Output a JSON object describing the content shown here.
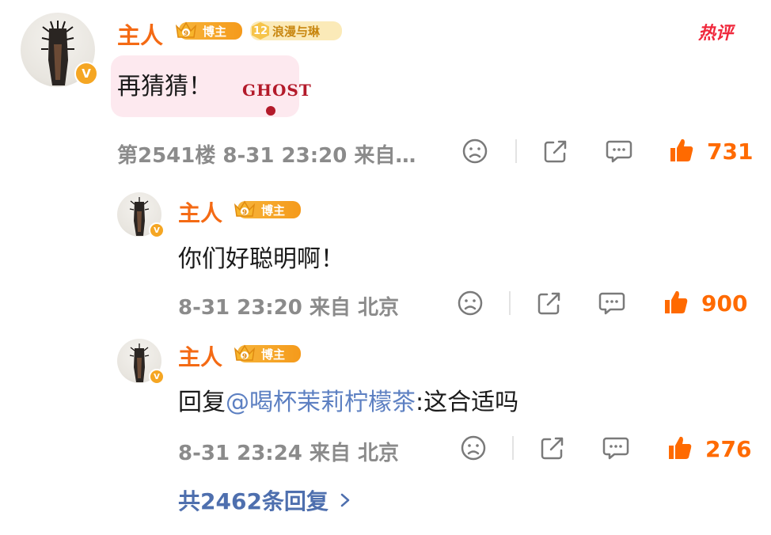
{
  "main_comment": {
    "author": "主人",
    "blogger_badge": "博主",
    "fan_level": "12",
    "fan_badge": "浪漫与琳",
    "hot_label": "热评",
    "text": "再猜猜！",
    "sticker_text": "GHOST",
    "meta": "第2541楼  8-31 23:20  来自…",
    "likes": "731"
  },
  "replies": [
    {
      "author": "主人",
      "blogger_badge": "博主",
      "text": "你们好聪明啊！",
      "meta": "8-31 23:20  来自 北京",
      "likes": "900"
    },
    {
      "author": "主人",
      "blogger_badge": "博主",
      "text_prefix": "回复",
      "mention": "@喝杯茉莉柠檬茶",
      "text_suffix": ":这合适吗",
      "meta": "8-31 23:24  来自 北京",
      "likes": "276"
    }
  ],
  "more_replies": "共2462条回复",
  "colors": {
    "name": "#f46a14",
    "like": "#ff6a00",
    "link": "#5d80c2",
    "hot": "#f0283c"
  },
  "icons": [
    "verified-v-icon",
    "crown-level-icon",
    "sad-face-icon",
    "share-icon",
    "comment-icon",
    "thumb-up-icon",
    "chevron-right-icon"
  ]
}
